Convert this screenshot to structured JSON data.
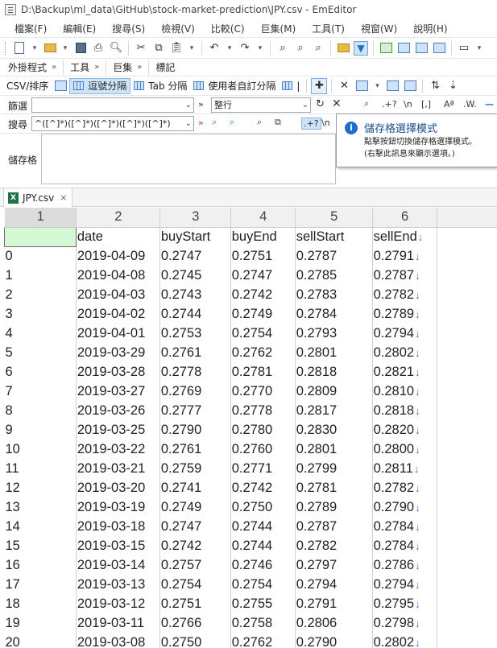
{
  "window": {
    "title": "D:\\Backup\\ml_data\\GitHub\\stock-market-prediction\\JPY.csv - EmEditor"
  },
  "menu": [
    "檔案(F)",
    "編輯(E)",
    "搜尋(S)",
    "檢視(V)",
    "比較(C)",
    "巨集(M)",
    "工具(T)",
    "視窗(W)",
    "說明(H)"
  ],
  "toolbar": {
    "plugins_label": "外掛程式",
    "tools_label": "工具",
    "macros_label": "巨集",
    "markers_label": "標記",
    "csv_sort_label": "CSV/排序",
    "comma_sep_label": "逗號分隔",
    "tab_sep_label": "Tab 分隔",
    "user_sep_label": "使用者自訂分隔",
    "pipe_label": "|"
  },
  "filter_bar": {
    "label": "篩選",
    "value": "",
    "scope_value": "整行",
    "arrow": "»",
    "regex_label": ".+?",
    "newline_label": "\\n",
    "bracket_label": "[,]",
    "case_label": "Aª",
    "word_label": ".W."
  },
  "search_bar": {
    "label": "搜尋",
    "value": "^([^]*)([^]*)([^]*)([^]*)([^]*)",
    "arrow": "»",
    "regex_label": ".+?",
    "newline_label": "\\n"
  },
  "cell_panel": {
    "label": "儲存格",
    "value": ""
  },
  "tooltip": {
    "title": "儲存格選擇模式",
    "line1": "點擊按鈕切換儲存格選擇模式。",
    "line2": "(右擊此訊息來顯示選項。)"
  },
  "tab": {
    "name": "JPY.csv",
    "close": "×"
  },
  "grid": {
    "column_numbers": [
      "1",
      "2",
      "3",
      "4",
      "5",
      "6"
    ],
    "headers": [
      "",
      "date",
      "buyStart",
      "buyEnd",
      "sellStart",
      "sellEnd"
    ],
    "rows": [
      [
        "0",
        "2019-04-09",
        "0.2747",
        "0.2751",
        "0.2787",
        "0.2791"
      ],
      [
        "1",
        "2019-04-08",
        "0.2745",
        "0.2747",
        "0.2785",
        "0.2787"
      ],
      [
        "2",
        "2019-04-03",
        "0.2743",
        "0.2742",
        "0.2783",
        "0.2782"
      ],
      [
        "3",
        "2019-04-02",
        "0.2744",
        "0.2749",
        "0.2784",
        "0.2789"
      ],
      [
        "4",
        "2019-04-01",
        "0.2753",
        "0.2754",
        "0.2793",
        "0.2794"
      ],
      [
        "5",
        "2019-03-29",
        "0.2761",
        "0.2762",
        "0.2801",
        "0.2802"
      ],
      [
        "6",
        "2019-03-28",
        "0.2778",
        "0.2781",
        "0.2818",
        "0.2821"
      ],
      [
        "7",
        "2019-03-27",
        "0.2769",
        "0.2770",
        "0.2809",
        "0.2810"
      ],
      [
        "8",
        "2019-03-26",
        "0.2777",
        "0.2778",
        "0.2817",
        "0.2818"
      ],
      [
        "9",
        "2019-03-25",
        "0.2790",
        "0.2780",
        "0.2830",
        "0.2820"
      ],
      [
        "10",
        "2019-03-22",
        "0.2761",
        "0.2760",
        "0.2801",
        "0.2800"
      ],
      [
        "11",
        "2019-03-21",
        "0.2759",
        "0.2771",
        "0.2799",
        "0.2811"
      ],
      [
        "12",
        "2019-03-20",
        "0.2741",
        "0.2742",
        "0.2781",
        "0.2782"
      ],
      [
        "13",
        "2019-03-19",
        "0.2749",
        "0.2750",
        "0.2789",
        "0.2790"
      ],
      [
        "14",
        "2019-03-18",
        "0.2747",
        "0.2744",
        "0.2787",
        "0.2784"
      ],
      [
        "15",
        "2019-03-15",
        "0.2742",
        "0.2744",
        "0.2782",
        "0.2784"
      ],
      [
        "16",
        "2019-03-14",
        "0.2757",
        "0.2746",
        "0.2797",
        "0.2786"
      ],
      [
        "17",
        "2019-03-13",
        "0.2754",
        "0.2754",
        "0.2794",
        "0.2794"
      ],
      [
        "18",
        "2019-03-12",
        "0.2751",
        "0.2755",
        "0.2791",
        "0.2795"
      ],
      [
        "19",
        "2019-03-11",
        "0.2766",
        "0.2758",
        "0.2806",
        "0.2798"
      ],
      [
        "20",
        "2019-03-08",
        "0.2750",
        "0.2762",
        "0.2790",
        "0.2802"
      ]
    ],
    "newline_marker": "↓"
  },
  "colors": {
    "selected_cell": "#d4f7d4",
    "accent": "#1e6ed2",
    "newline_marker": "#2b7bd8"
  }
}
